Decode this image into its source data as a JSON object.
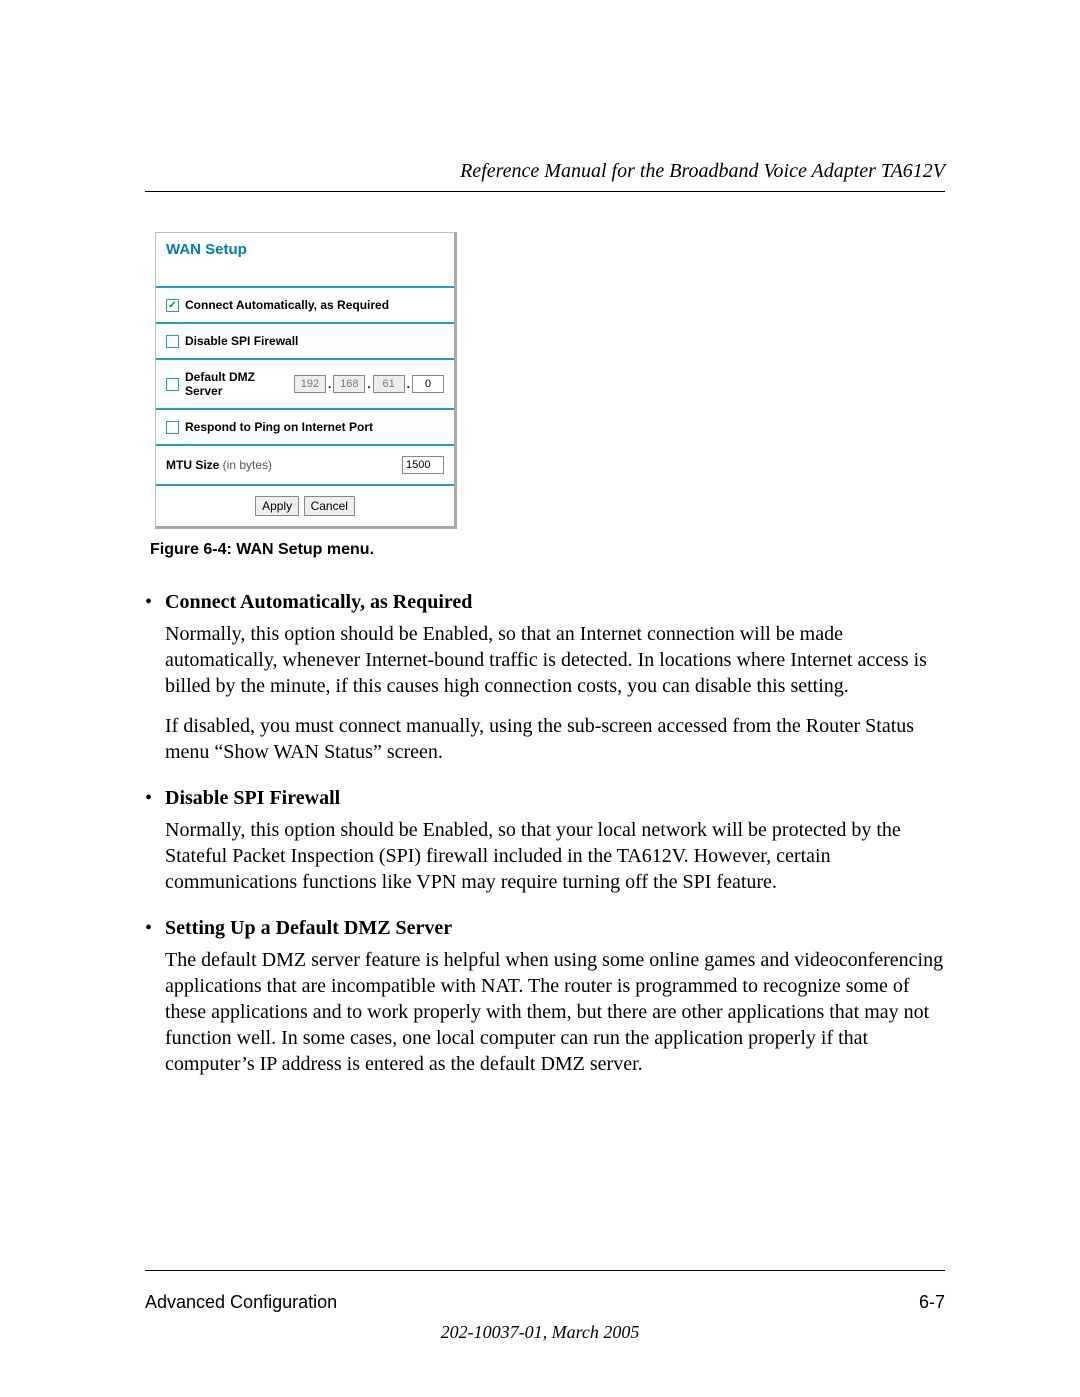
{
  "header": {
    "title": "Reference Manual for the Broadband Voice Adapter TA612V"
  },
  "panel": {
    "title": "WAN Setup",
    "rows": {
      "connect_auto": {
        "label": "Connect Automatically, as Required",
        "checked": true
      },
      "disable_spi": {
        "label": "Disable SPI Firewall",
        "checked": false
      },
      "dmz": {
        "label": "Default DMZ Server",
        "checked": false,
        "ip": {
          "o1": "192",
          "o2": "168",
          "o3": "61",
          "o4": "0"
        }
      },
      "respond_ping": {
        "label": "Respond to Ping on Internet Port",
        "checked": false
      },
      "mtu": {
        "label_bold": "MTU Size",
        "label_light": " (in bytes)",
        "value": "1500"
      }
    },
    "buttons": {
      "apply": "Apply",
      "cancel": "Cancel"
    }
  },
  "figure_caption": "Figure 6-4:  WAN Setup menu.",
  "items": [
    {
      "title": "Connect Automatically, as Required",
      "paras": [
        "Normally, this option should be Enabled, so that an Internet connection will be made automatically, whenever Internet-bound traffic is detected. In locations where Internet access is billed by the minute, if this causes high connection costs, you can disable this setting.",
        "If disabled, you must connect manually, using the sub-screen accessed from the Router Status menu “Show WAN Status” screen."
      ]
    },
    {
      "title": "Disable SPI Firewall",
      "paras": [
        "Normally, this option should be Enabled, so that your local network will be protected by the Stateful Packet Inspection (SPI) firewall included in the TA612V. However, certain communications functions like VPN may require turning off the SPI feature."
      ]
    },
    {
      "title": "Setting Up a Default DMZ Server",
      "paras": [
        "The default DMZ server feature is helpful when using some online games and videoconferencing applications that are incompatible with NAT. The router is programmed to recognize some of these applications and to work properly with them, but there are other applications that may not function well. In some cases, one local computer can run the application properly if that computer’s IP address is entered as the default DMZ server."
      ]
    }
  ],
  "footer": {
    "left": "Advanced Configuration",
    "right": "6-7",
    "docid": "202-10037-01, March 2005"
  }
}
